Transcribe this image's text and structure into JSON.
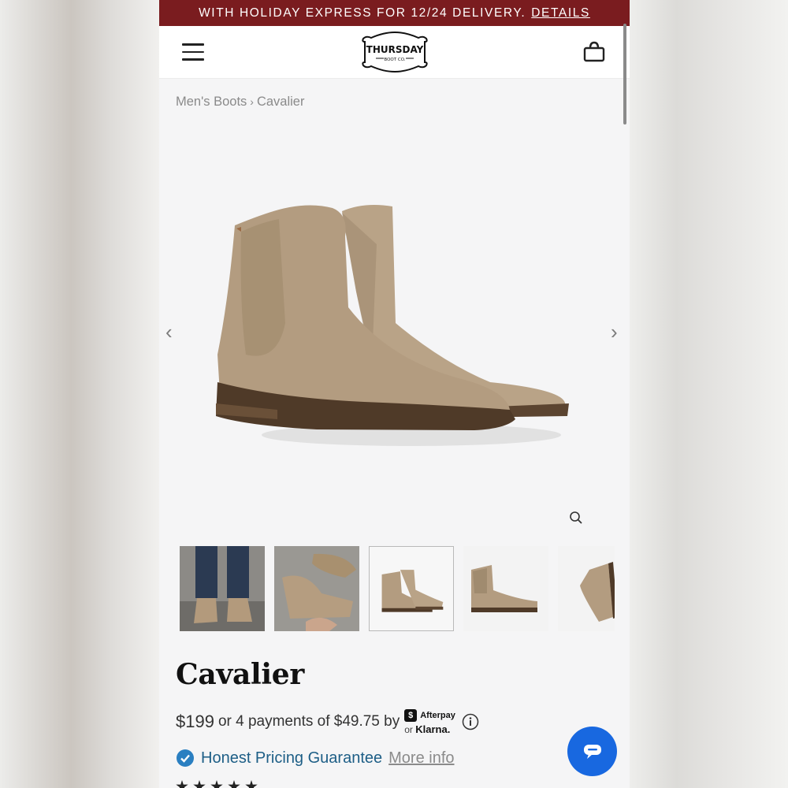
{
  "promo_banner": {
    "text": "WITH HOLIDAY EXPRESS FOR 12/24 DELIVERY.",
    "link": "DETAILS",
    "color": "#7a1c1f"
  },
  "header": {
    "logo_line1": "THURSDAY",
    "logo_line2": "BOOT CO.",
    "menu_icon": "hamburger-icon",
    "cart_icon": "shopping-bag-icon"
  },
  "breadcrumb": {
    "items": [
      "Men's Boots",
      "Cavalier"
    ],
    "separator": "›"
  },
  "gallery": {
    "prev_arrow": "‹",
    "next_arrow": "›",
    "zoom_icon": "magnifier-icon",
    "selected_index": 2,
    "thumbnail_count": 5
  },
  "product": {
    "name": "Cavalier",
    "price": "$199",
    "installments": "or 4 payments of $49.75 by",
    "afterpay_label": "Afterpay",
    "klarna_prefix": "or",
    "klarna_label": "Klarna.",
    "guarantee": "Honest Pricing Guarantee",
    "more_info": "More info"
  },
  "colors": {
    "accent_blue": "#1868e0",
    "guarantee_blue": "#1d5e86",
    "check_blue": "#2a7fc1",
    "suede": "#b09a80"
  }
}
